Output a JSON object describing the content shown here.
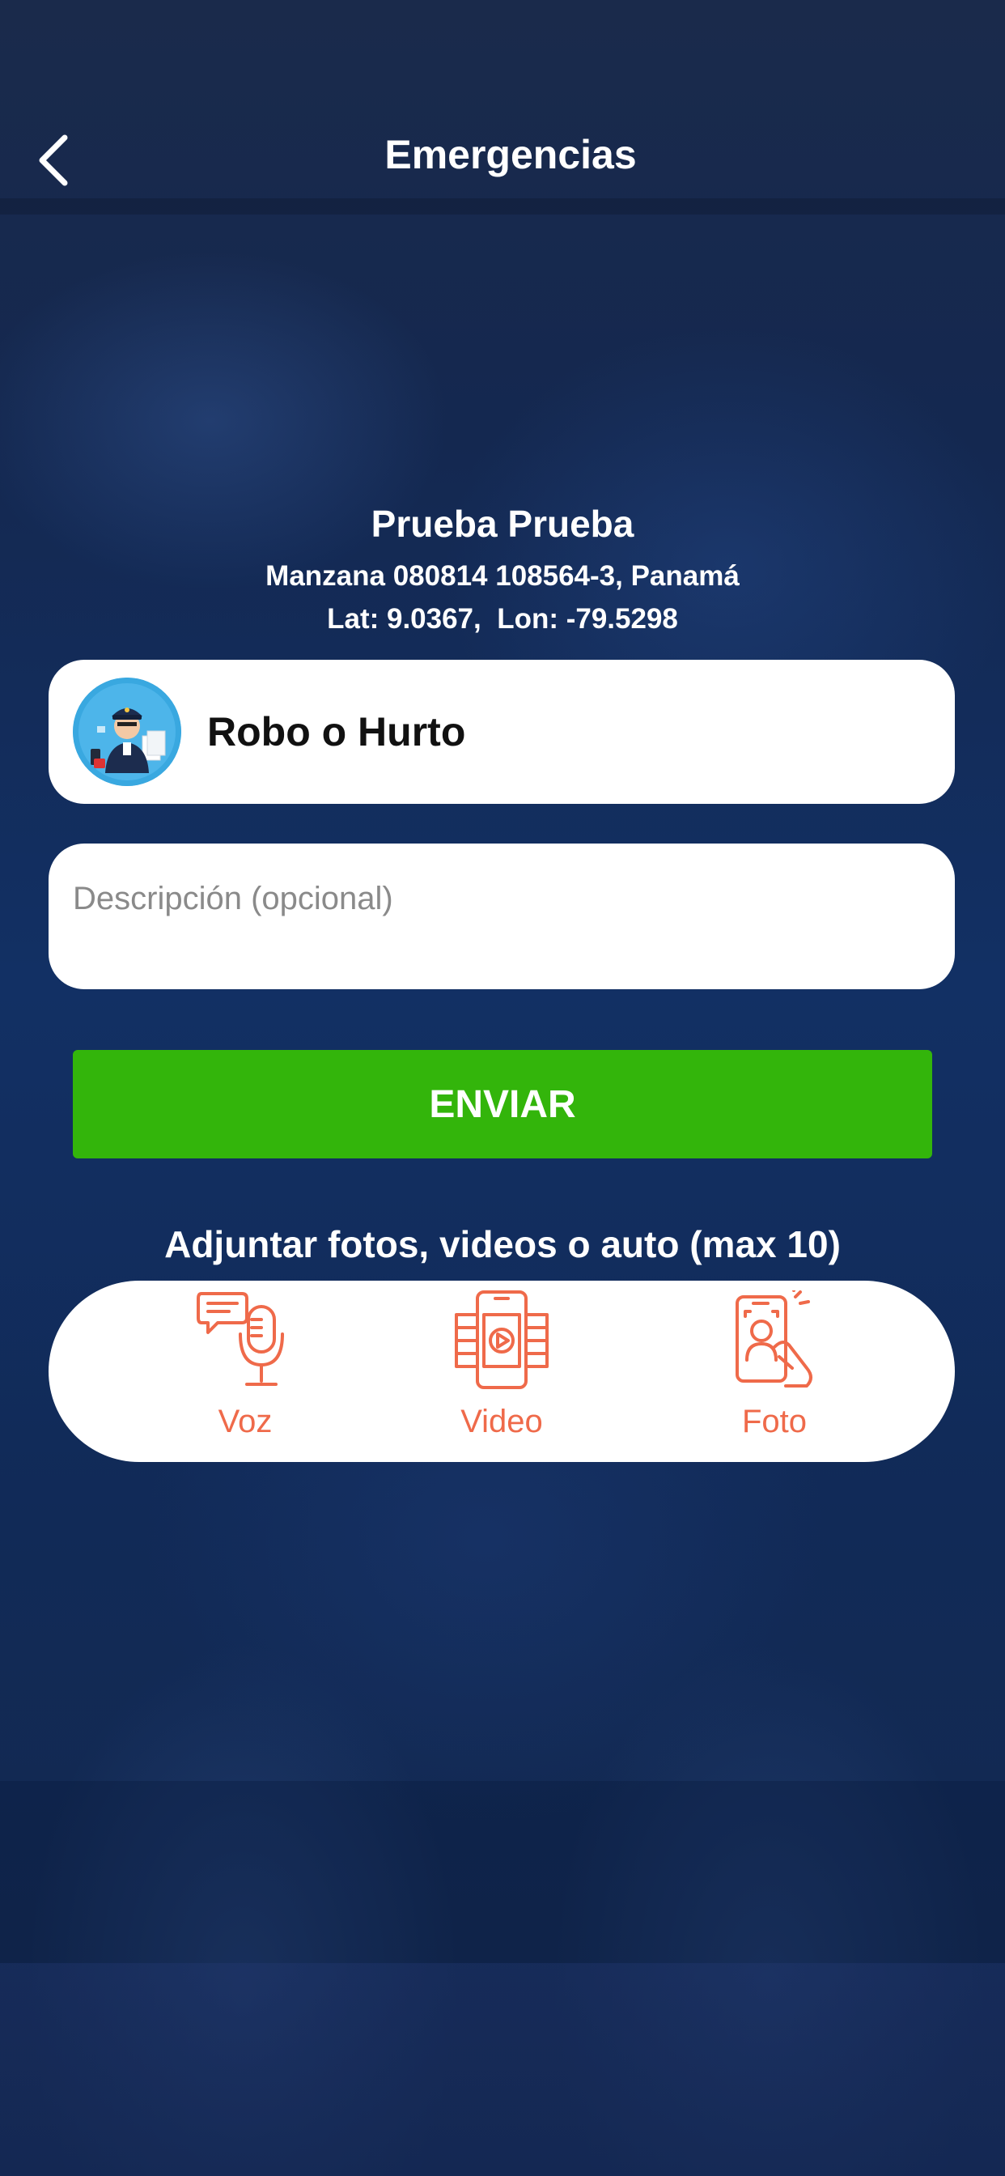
{
  "header": {
    "title": "Emergencias"
  },
  "user": {
    "name": "Prueba Prueba",
    "address": "Manzana 080814 108564-3, Panamá",
    "coords": "Lat: 9.0367,  Lon: -79.5298"
  },
  "category": {
    "label": "Robo o Hurto",
    "icon": "police-officer-icon"
  },
  "description": {
    "placeholder": "Descripción (opcional)",
    "value": ""
  },
  "send_label": "ENVIAR",
  "attachments": {
    "label": "Adjuntar fotos, videos o auto (max 10)",
    "items": [
      {
        "label": "Voz",
        "icon": "microphone-icon"
      },
      {
        "label": "Video",
        "icon": "video-icon"
      },
      {
        "label": "Foto",
        "icon": "photo-icon"
      }
    ]
  },
  "colors": {
    "primary_bg": "#14284d",
    "send_button": "#33b50b",
    "accent": "#ef6a4a",
    "avatar_bg": "#39a8e0"
  }
}
